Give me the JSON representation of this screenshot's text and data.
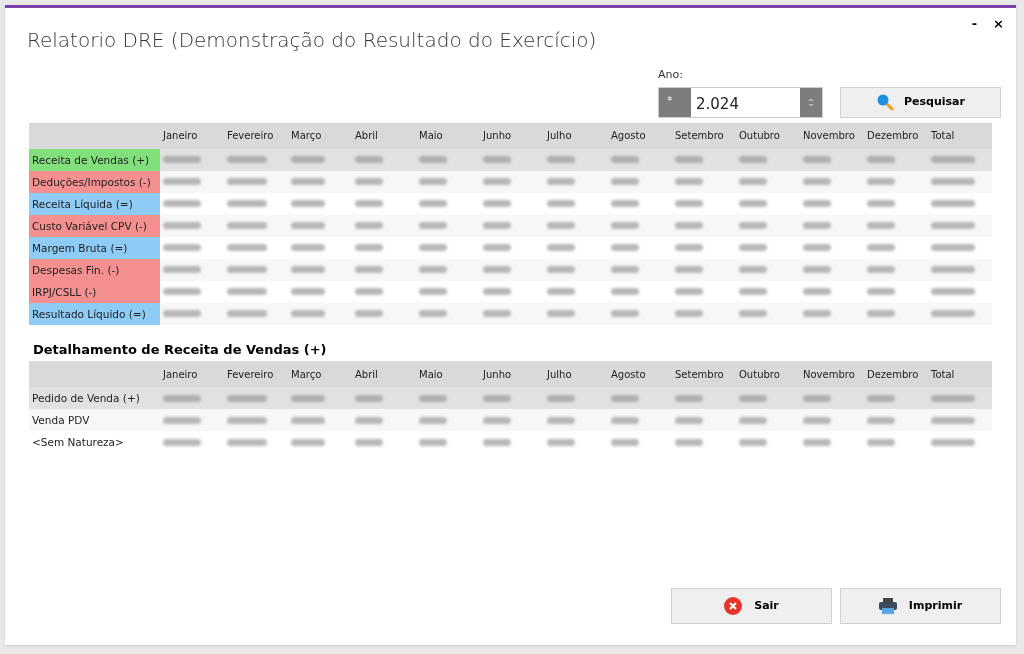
{
  "window": {
    "title": "Relatorio DRE (Demonstração do Resultado do Exercício)",
    "controls": [
      "-",
      "×"
    ]
  },
  "year_filter": {
    "label": "Ano:",
    "prefix": "*",
    "value": "2.024",
    "search_button": "Pesquisar"
  },
  "summary_table": {
    "columns": [
      "Janeiro",
      "Fevereiro",
      "Março",
      "Abril",
      "Maio",
      "Junho",
      "Julho",
      "Agosto",
      "Setembro",
      "Outubro",
      "Novembro",
      "Dezembro",
      "Total"
    ],
    "rows": [
      {
        "label": "Receita de Vendas (+)",
        "kind": "revenue",
        "selected": true
      },
      {
        "label": "Deduções/Impostos (-)",
        "kind": "deduction",
        "selected": false
      },
      {
        "label": "Receita Líquida (=)",
        "kind": "result",
        "selected": false
      },
      {
        "label": "Custo Variável CPV (-)",
        "kind": "deduction",
        "selected": false
      },
      {
        "label": "Margem Bruta (=)",
        "kind": "result",
        "selected": false
      },
      {
        "label": "Despesas Fin. (-)",
        "kind": "deduction",
        "selected": false
      },
      {
        "label": "IRPJ/CSLL (-)",
        "kind": "deduction",
        "selected": false
      },
      {
        "label": "Resultado Líquido (=)",
        "kind": "result",
        "selected": false
      }
    ]
  },
  "detail_section": {
    "title": "Detalhamento de Receita de Vendas (+)",
    "columns": [
      "Janeiro",
      "Fevereiro",
      "Março",
      "Abril",
      "Maio",
      "Junho",
      "Julho",
      "Agosto",
      "Setembro",
      "Outubro",
      "Novembro",
      "Dezembro",
      "Total"
    ],
    "rows": [
      {
        "label": "Pedido de Venda (+)",
        "selected": true
      },
      {
        "label": "Venda PDV",
        "selected": false
      },
      {
        "label": "<Sem Natureza>",
        "selected": false
      }
    ]
  },
  "buttons": [
    {
      "label": "Sair",
      "kind": "exit"
    },
    {
      "label": "Imprimir",
      "kind": "print"
    }
  ]
}
